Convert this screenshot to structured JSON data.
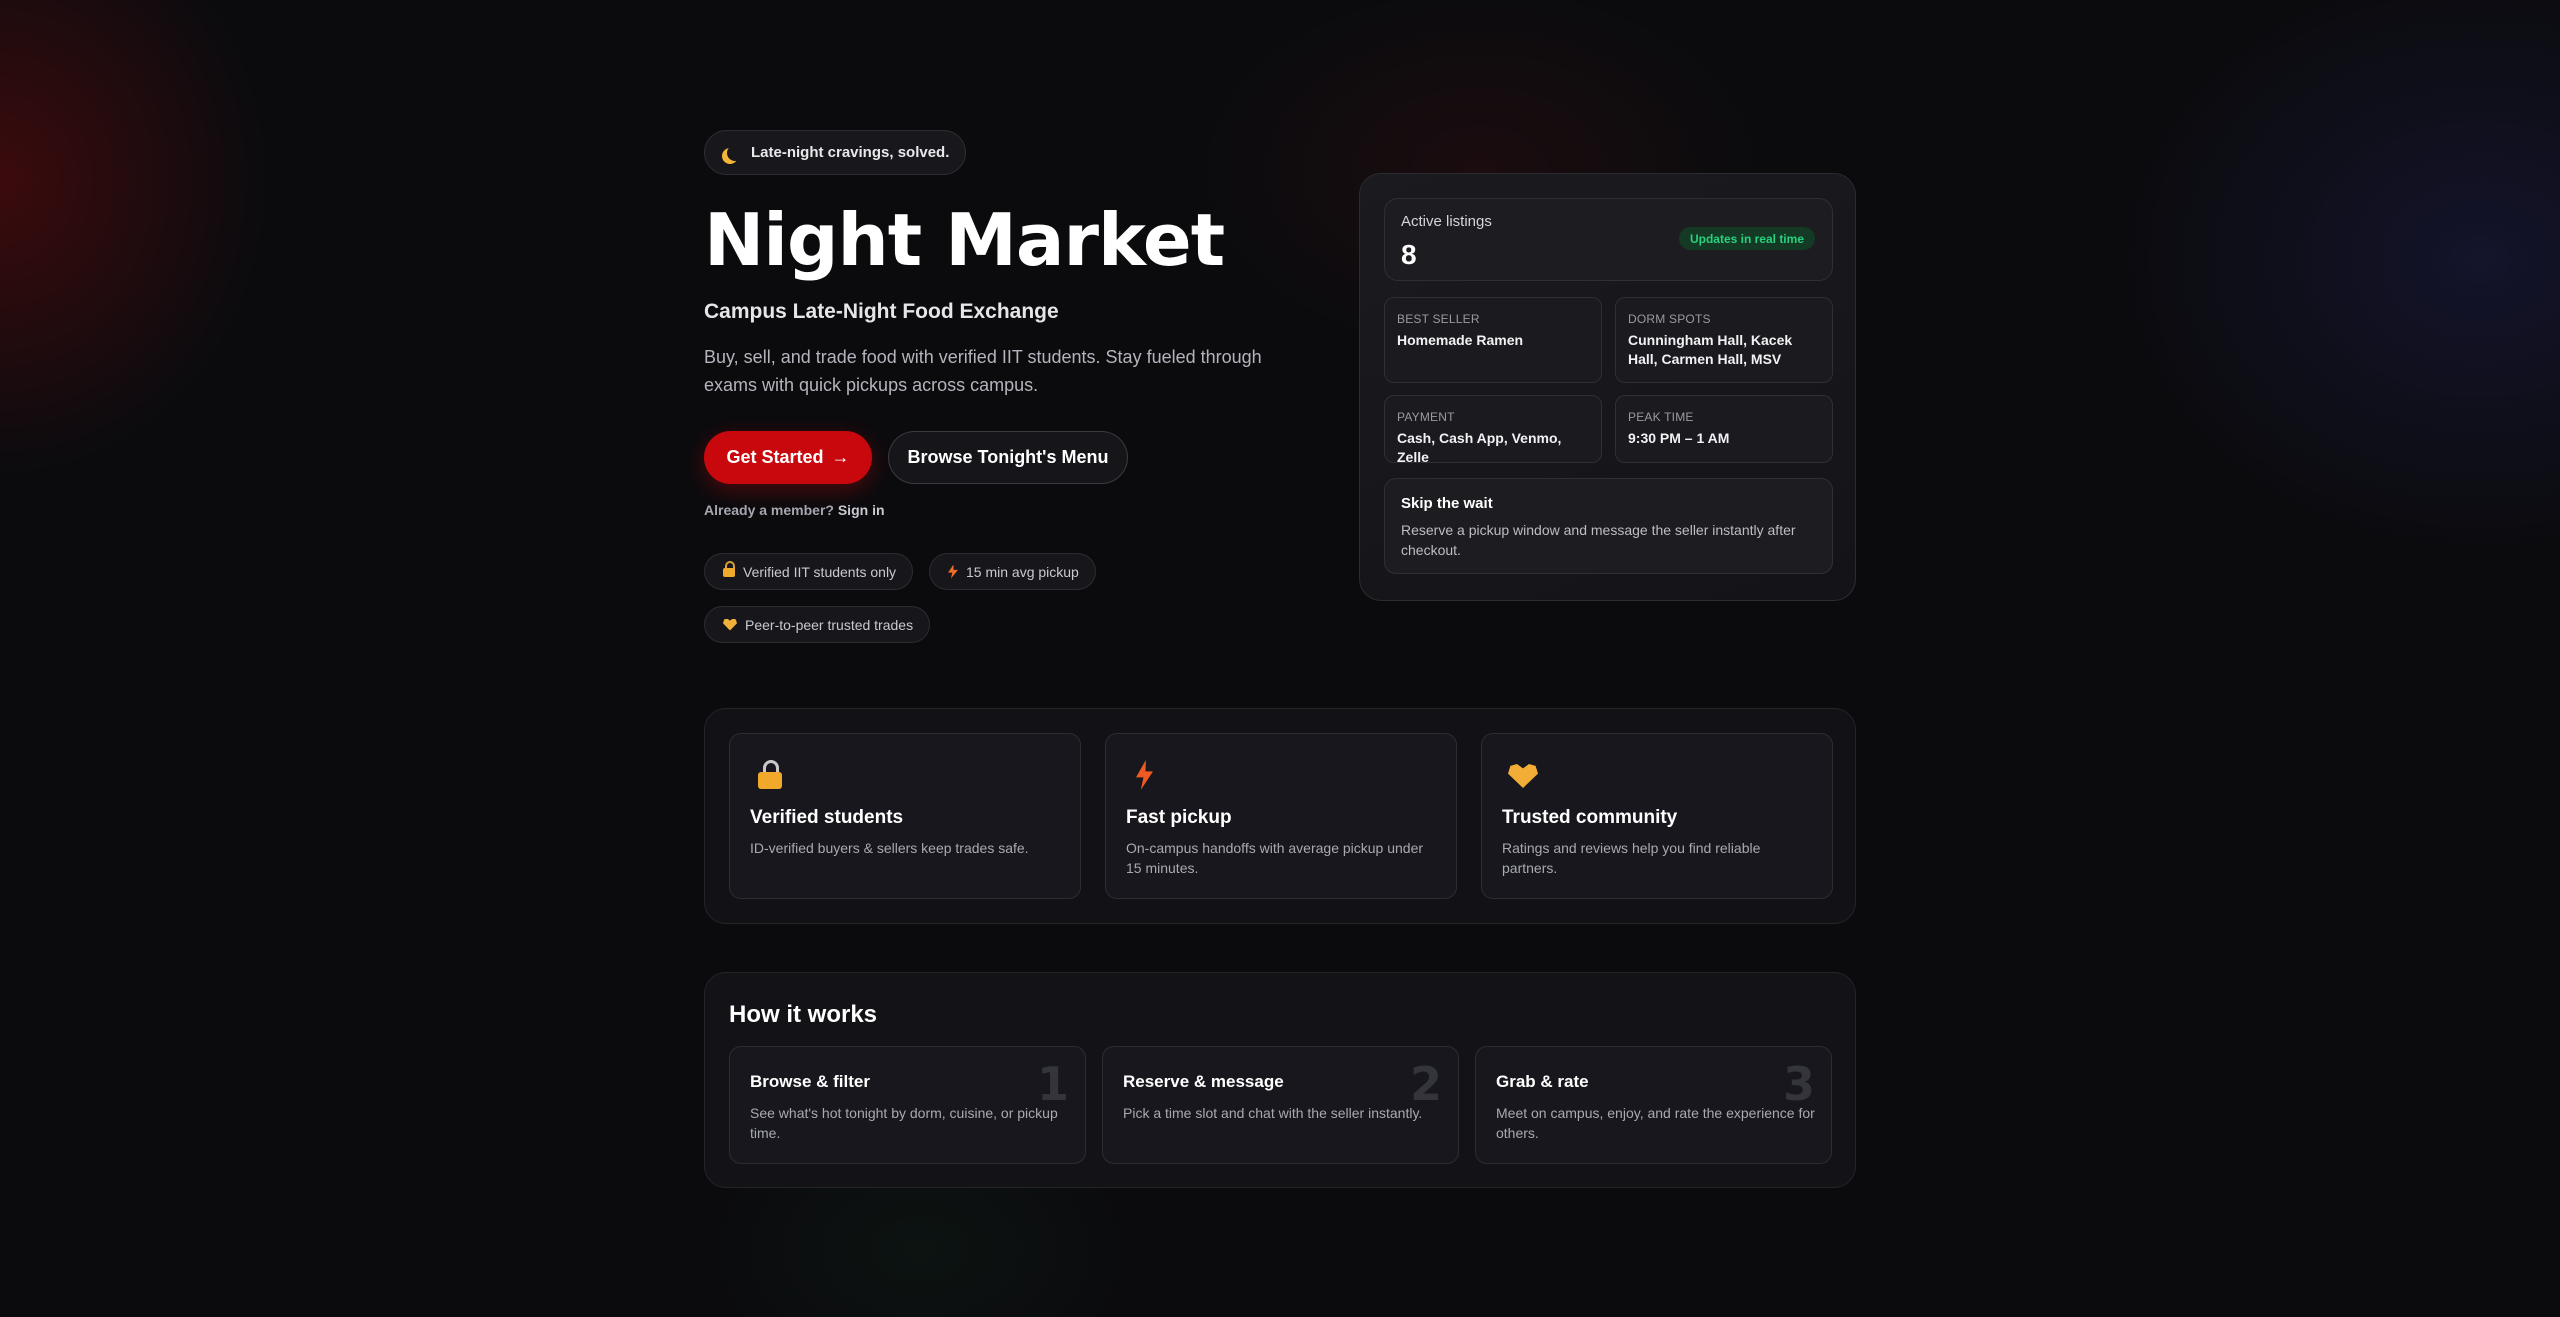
{
  "hero": {
    "tagline": "Late-night cravings, solved.",
    "title": "Night Market",
    "subtitle": "Campus Late-Night Food Exchange",
    "description": "Buy, sell, and trade food with verified IIT students. Stay fueled through exams with quick pickups across campus.",
    "primary_cta": "Get Started",
    "primary_cta_arrow": "→",
    "secondary_cta": "Browse Tonight's Menu",
    "signin_prefix": "Already a member?",
    "signin_link": "Sign in",
    "chips": [
      {
        "icon": "lock-icon",
        "label": "Verified IIT students only"
      },
      {
        "icon": "lightning-icon",
        "label": "15 min avg pickup"
      },
      {
        "icon": "heart-icon",
        "label": "Peer-to-peer trusted trades"
      }
    ]
  },
  "stats": {
    "active_label": "Active listings",
    "active_value": "8",
    "live_badge": "Updates in real time",
    "best_seller_label": "BEST SELLER",
    "best_seller_value": "Homemade Ramen",
    "dorm_label": "DORM SPOTS",
    "dorm_value": "Cunningham Hall, Kacek Hall, Carmen Hall, MSV",
    "payment_label": "PAYMENT",
    "payment_value": "Cash, Cash App, Venmo, Zelle",
    "peak_label": "PEAK TIME",
    "peak_value": "9:30 PM – 1 AM",
    "skip_title": "Skip the wait",
    "skip_text": "Reserve a pickup window and message the seller instantly after checkout."
  },
  "features": [
    {
      "icon": "lock-icon",
      "title": "Verified students",
      "text": "ID-verified buyers & sellers keep trades safe."
    },
    {
      "icon": "lightning-icon",
      "title": "Fast pickup",
      "text": "On-campus handoffs with average pickup under 15 minutes."
    },
    {
      "icon": "heart-icon",
      "title": "Trusted community",
      "text": "Ratings and reviews help you find reliable partners."
    }
  ],
  "how": {
    "title": "How it works",
    "steps": [
      {
        "number": "1",
        "title": "Browse & filter",
        "text": "See what's hot tonight by dorm, cuisine, or pickup time."
      },
      {
        "number": "2",
        "title": "Reserve & message",
        "text": "Pick a time slot and chat with the seller instantly."
      },
      {
        "number": "3",
        "title": "Grab & rate",
        "text": "Meet on campus, enjoy, and rate the experience for others."
      }
    ]
  },
  "colors": {
    "accent": "#c8080c",
    "live": "#29d17c",
    "background": "#0b0b0e"
  }
}
